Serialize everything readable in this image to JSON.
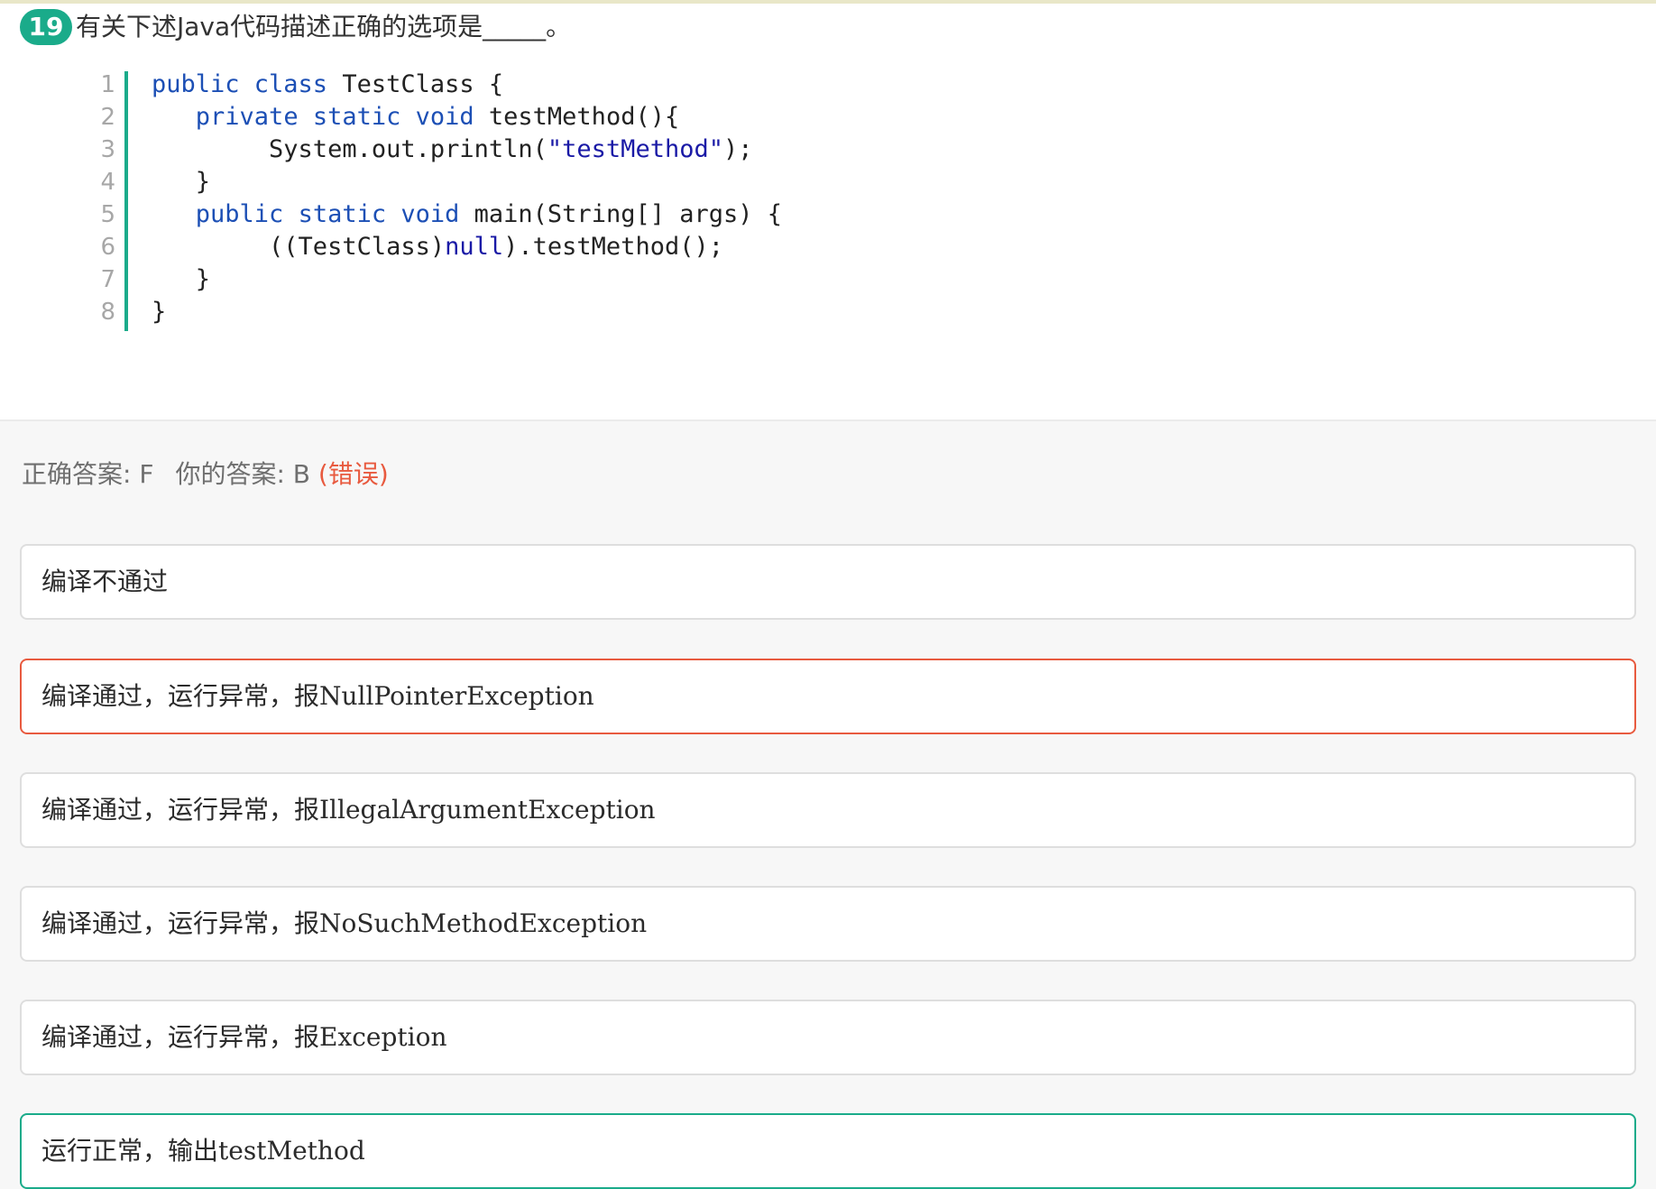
{
  "question": {
    "number": "19",
    "text": "有关下述Java代码描述正确的选项是_____。"
  },
  "code": {
    "line_numbers": [
      "1",
      "2",
      "3",
      "4",
      "5",
      "6",
      "7",
      "8"
    ],
    "lines": [
      [
        {
          "t": "public class",
          "k": "kw"
        },
        {
          "t": " TestClass {",
          "k": "ident"
        }
      ],
      [
        {
          "t": "   "
        },
        {
          "t": "private static void",
          "k": "kw"
        },
        {
          "t": " testMethod(){",
          "k": "ident"
        }
      ],
      [
        {
          "t": "        System.out.println(",
          "k": "ident"
        },
        {
          "t": "\"testMethod\"",
          "k": "str"
        },
        {
          "t": ");",
          "k": "ident"
        }
      ],
      [
        {
          "t": "   }",
          "k": "ident"
        }
      ],
      [
        {
          "t": "   "
        },
        {
          "t": "public static void",
          "k": "kw"
        },
        {
          "t": " main(String[] args) {",
          "k": "ident"
        }
      ],
      [
        {
          "t": "        ((TestClass)",
          "k": "ident"
        },
        {
          "t": "null",
          "k": "blue"
        },
        {
          "t": ").testMethod();",
          "k": "ident"
        }
      ],
      [
        {
          "t": "   }",
          "k": "ident"
        }
      ],
      [
        {
          "t": "}",
          "k": "ident"
        }
      ]
    ]
  },
  "answer": {
    "correct_label": "正确答案: F",
    "your_label": "你的答案: B",
    "status": "(错误)"
  },
  "options": [
    {
      "text": "编译不通过",
      "state": "normal"
    },
    {
      "text": "编译通过，运行异常，报NullPointerException",
      "state": "selected-wrong"
    },
    {
      "text": "编译通过，运行异常，报IllegalArgumentException",
      "state": "normal"
    },
    {
      "text": "编译通过，运行异常，报NoSuchMethodException",
      "state": "normal"
    },
    {
      "text": "编译通过，运行异常，报Exception",
      "state": "normal"
    },
    {
      "text": "运行正常，输出testMethod",
      "state": "correct"
    }
  ],
  "colors": {
    "accent": "#1aab8a",
    "wrong": "#e85a3f",
    "keyword": "#1c4fb5"
  }
}
